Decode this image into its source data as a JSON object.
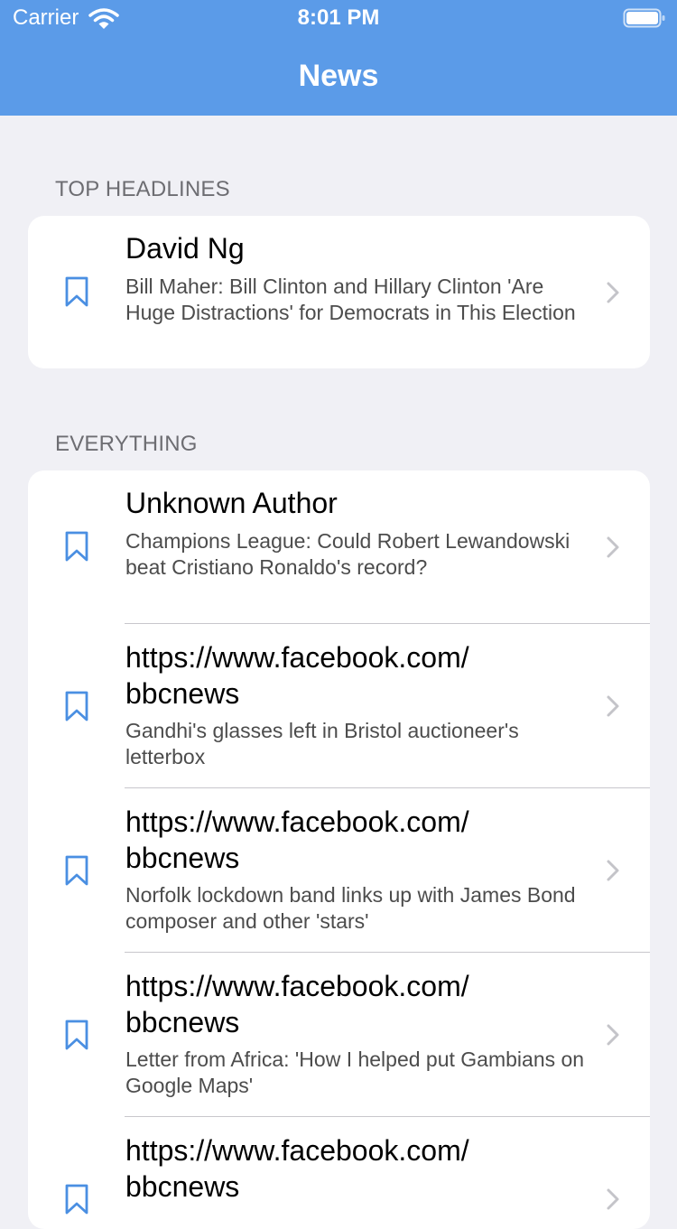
{
  "status_bar": {
    "carrier": "Carrier",
    "time": "8:01 PM"
  },
  "nav": {
    "title": "News"
  },
  "colors": {
    "nav_bar": "#5b9be8",
    "accent": "#4a8fe2",
    "background": "#f0f0f5"
  },
  "sections": [
    {
      "header": "TOP HEADLINES",
      "rows": [
        {
          "title": "David Ng",
          "subtitle": "Bill Maher: Bill Clinton and Hillary Clinton 'Are Huge Distractions' for Democrats in This Election"
        }
      ]
    },
    {
      "header": "EVERYTHING",
      "rows": [
        {
          "title": "Unknown Author",
          "subtitle": "Champions League: Could Robert Lewandowski beat Cristiano Ronaldo's record?"
        },
        {
          "title": "https://www.facebook.com/\nbbcnews",
          "subtitle": "Gandhi's glasses left in Bristol auctioneer's letterbox"
        },
        {
          "title": "https://www.facebook.com/\nbbcnews",
          "subtitle": "Norfolk lockdown band links up with James Bond composer and other 'stars'"
        },
        {
          "title": "https://www.facebook.com/\nbbcnews",
          "subtitle": "Letter from Africa: 'How I helped put Gambians on Google Maps'"
        },
        {
          "title": "https://www.facebook.com/\nbbcnews",
          "subtitle": ""
        }
      ]
    }
  ]
}
